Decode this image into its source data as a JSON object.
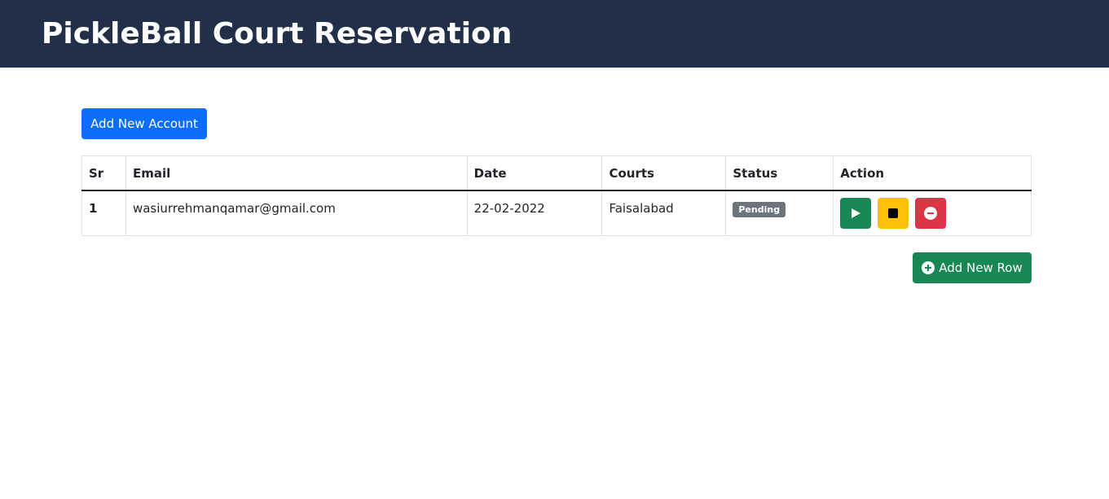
{
  "header": {
    "title": "PickleBall Court Reservation"
  },
  "actions": {
    "add_account_label": "Add New Account",
    "add_row_label": "Add New Row"
  },
  "table": {
    "columns": [
      "Sr",
      "Email",
      "Date",
      "Courts",
      "Status",
      "Action"
    ],
    "rows": [
      {
        "sr": "1",
        "email": "wasiurrehmanqamar@gmail.com",
        "date": "22-02-2022",
        "court": "Faisalabad",
        "status": "Pending",
        "row_actions": [
          "play-icon",
          "stop-icon",
          "remove-circle-icon"
        ]
      }
    ]
  },
  "colors": {
    "navbar": "#212f48",
    "primary": "#0d6efd",
    "success": "#198754",
    "warning": "#ffc107",
    "danger": "#dc3545",
    "secondary": "#6c757d"
  }
}
